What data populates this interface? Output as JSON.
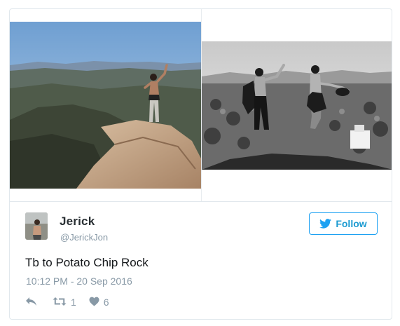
{
  "tweet": {
    "author_name": "Jerick",
    "author_handle": "@JerickJon",
    "follow_label": "Follow",
    "text": "Tb to Potato Chip Rock",
    "timestamp": "10:12 PM - 20 Sep 2016",
    "retweet_count": "1",
    "like_count": "6"
  },
  "colors": {
    "accent": "#1da1f2",
    "muted": "#8899a6",
    "text": "#14171a",
    "border": "#e1e8ed"
  },
  "icons": {
    "follow": "twitter-bird-icon",
    "reply": "reply-arrow-icon",
    "retweet": "retweet-icon",
    "like": "heart-icon"
  }
}
